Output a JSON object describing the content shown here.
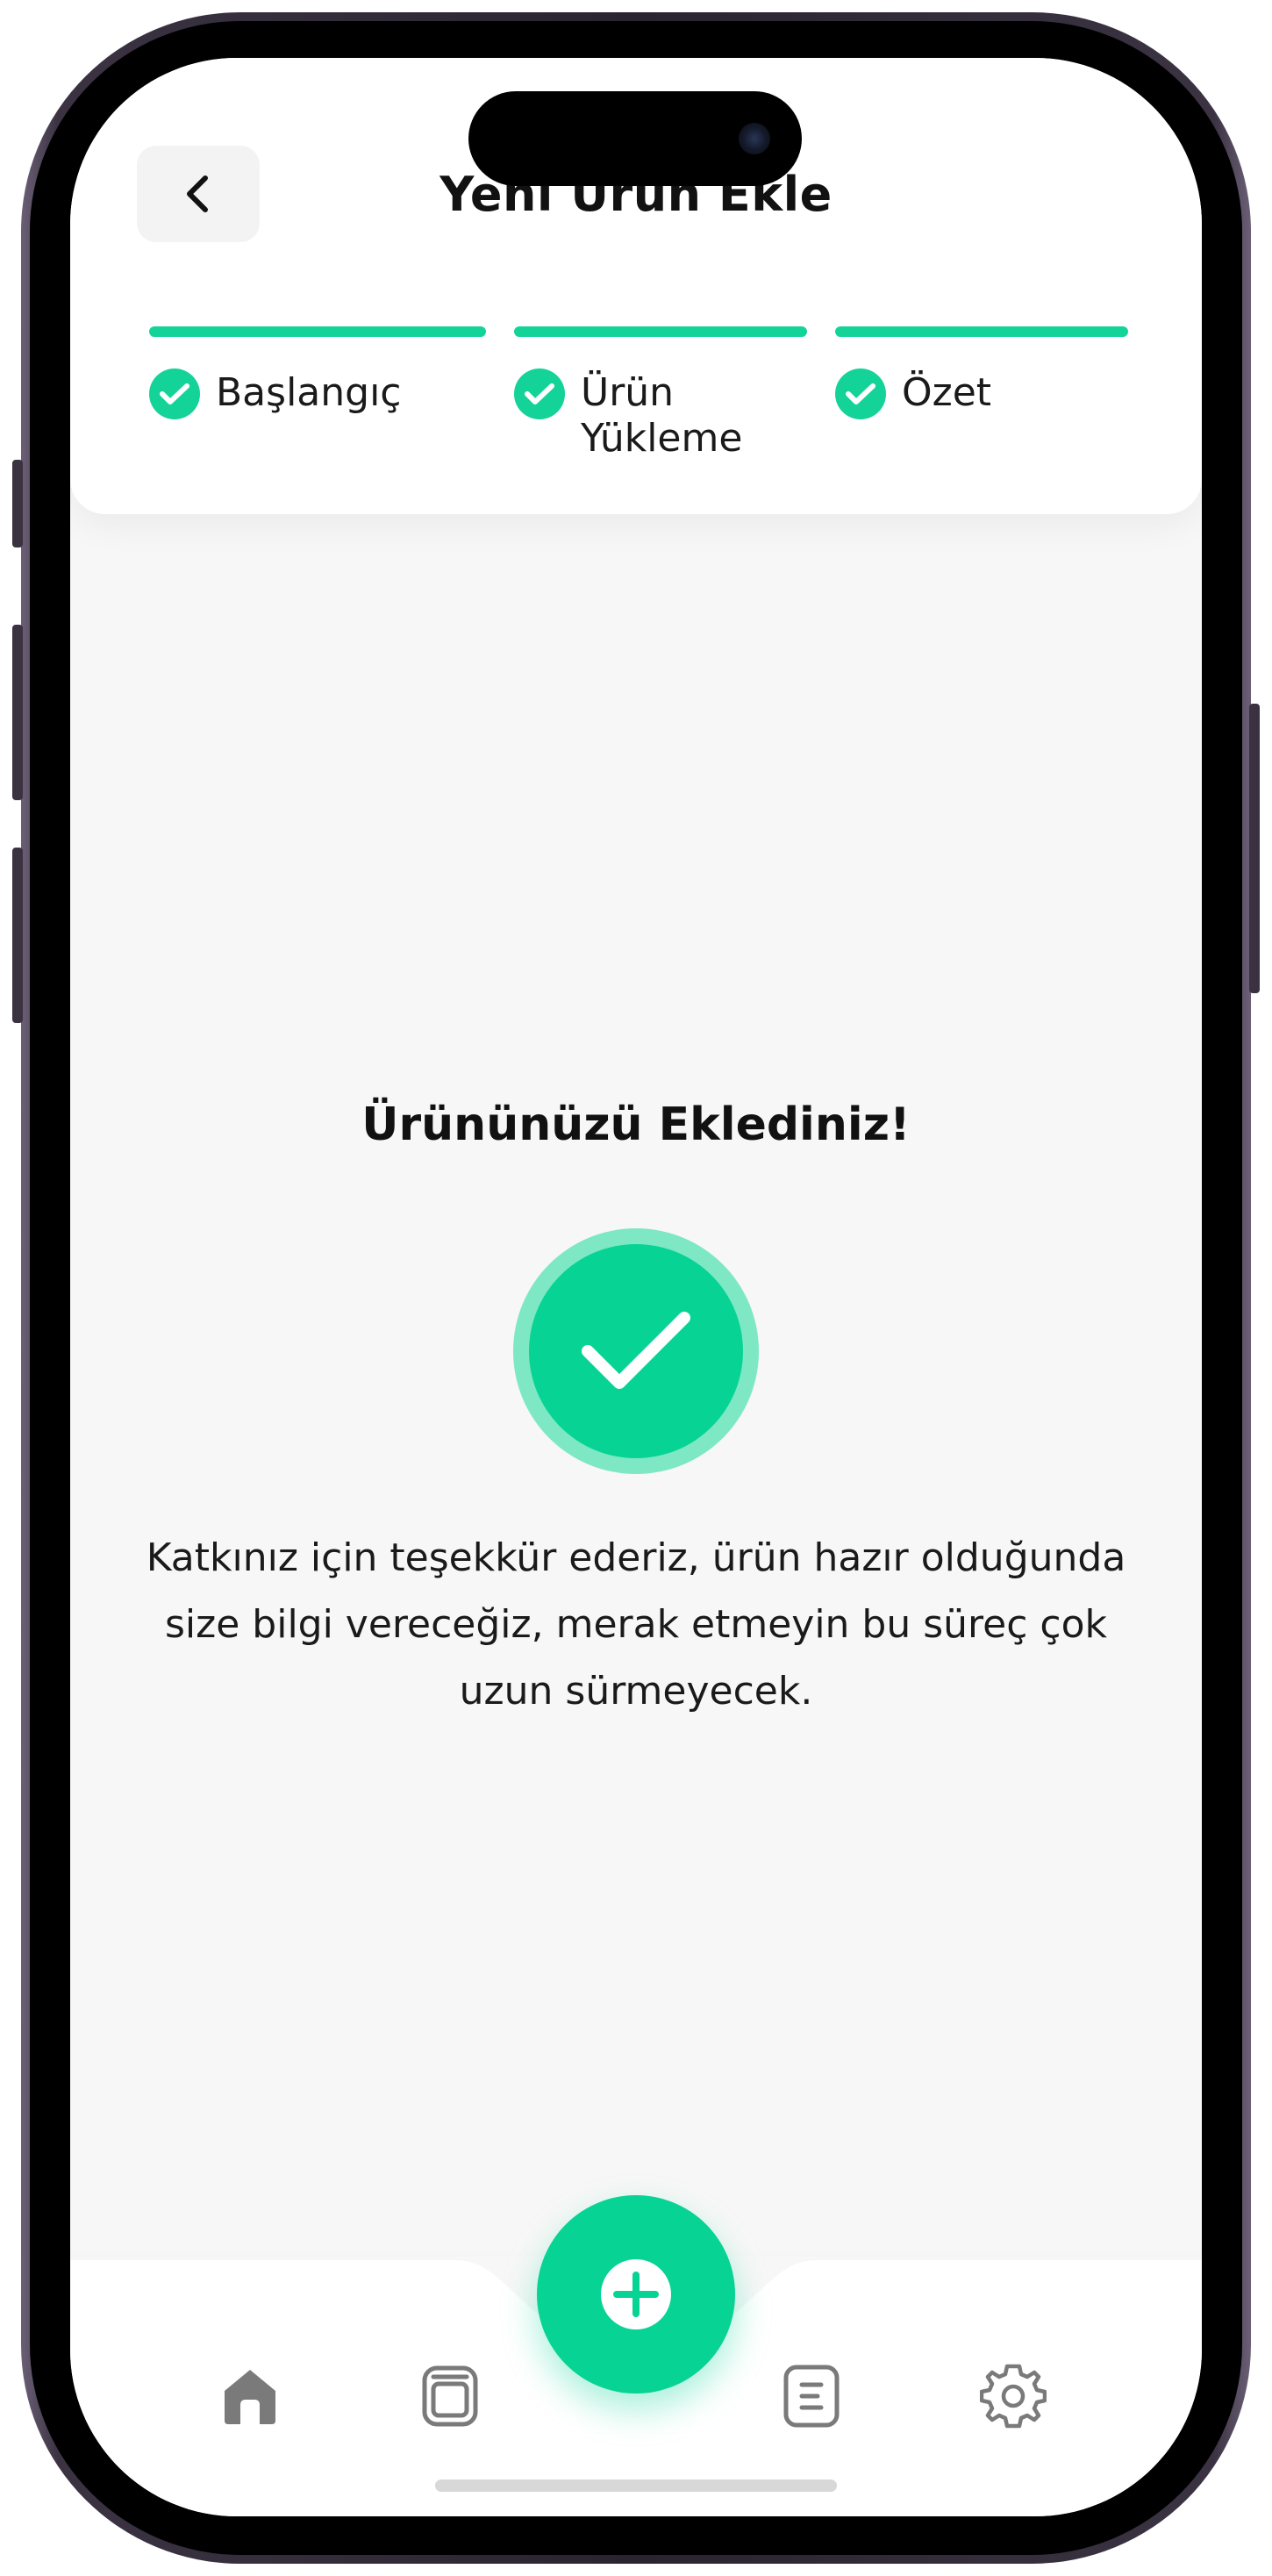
{
  "header": {
    "title": "Yeni Ürün Ekle",
    "back_icon": "chevron-left-icon"
  },
  "steps": [
    {
      "label": "Başlangıç",
      "completed": true
    },
    {
      "label": "Ürün Yükleme",
      "label_line1": "Ürün",
      "label_line2": "Yükleme",
      "completed": true
    },
    {
      "label": "Özet",
      "completed": true
    }
  ],
  "success": {
    "title": "Ürününüzü Eklediniz!",
    "message": "Katkınız için teşekkür ederiz, ürün hazır olduğunda size bilgi vereceğiz, merak etmeyin bu süreç çok uzun sürmeyecek.",
    "icon": "checkmark-icon"
  },
  "bottom_nav": {
    "items": [
      {
        "icon": "home-icon",
        "active": true
      },
      {
        "icon": "gallery-icon",
        "active": false
      },
      {
        "icon": "add-icon",
        "primary": true
      },
      {
        "icon": "document-icon",
        "active": false
      },
      {
        "icon": "settings-icon",
        "active": false
      }
    ]
  },
  "colors": {
    "accent": "#07d394",
    "accent_light": "#7de8c3",
    "background": "#f7f7f7",
    "card": "#ffffff",
    "text": "#111111",
    "icon_gray": "#7a7a7a"
  }
}
